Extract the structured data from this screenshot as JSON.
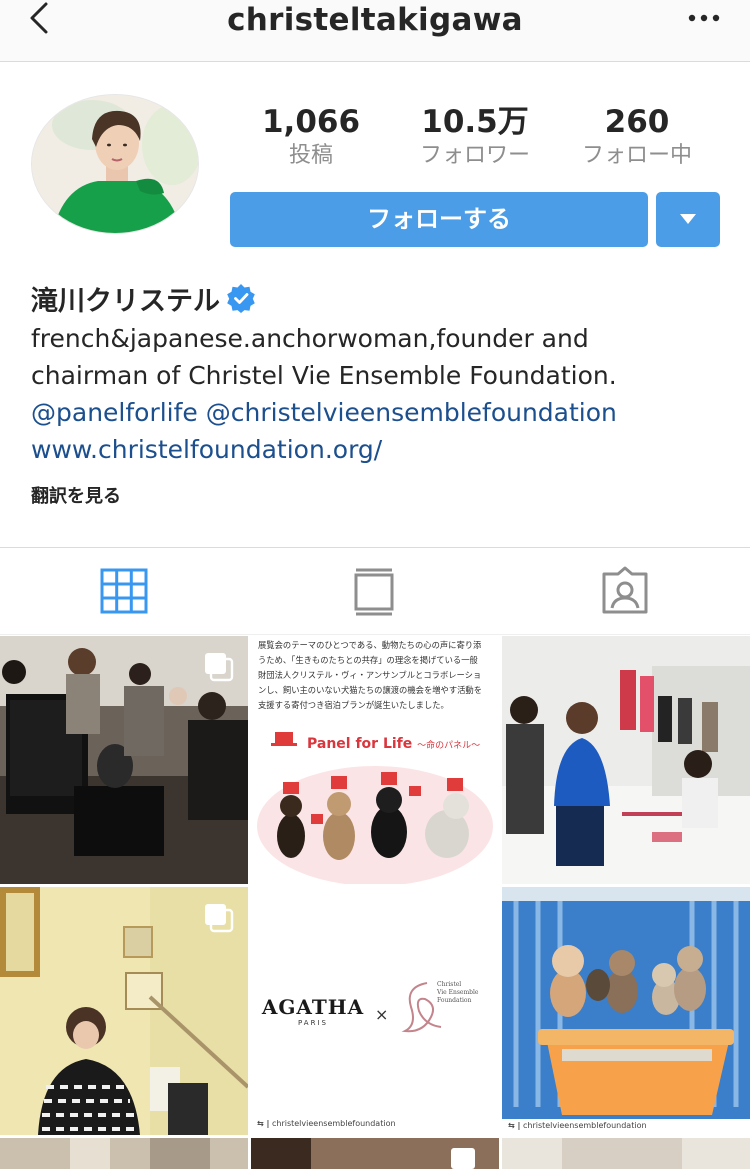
{
  "header": {
    "title": "christeltakigawa"
  },
  "profile": {
    "stats": {
      "posts_count": "1,066",
      "posts_label": "投稿",
      "followers_count": "10.5万",
      "followers_label": "フォロワー",
      "following_count": "260",
      "following_label": "フォロー中"
    },
    "follow_label": "フォローする",
    "name": "滝川クリステル",
    "bio_line1": "french&japanese.anchorwoman,founder and",
    "bio_line2": "chairman of Christel Vie Ensemble Foundation.",
    "mentions": "@panelforlife @christelvieensemblefoundation",
    "website": "www.christelfoundation.org/",
    "translate_label": "翻訳を見る"
  },
  "posts": {
    "post2": {
      "text_line1": "展覧会のテーマのひとつである、動物たちの心の声に寄り添",
      "text_line2": "うため、「生きものたちとの共存」の理念を掲げている一般",
      "text_line3": "財団法人クリステル・ヴィ・アンサンブルとコラボレーショ",
      "text_line4": "ンし、飼い主のいない犬猫たちの譲渡の機会を増やす活動を",
      "text_line5": "支援する寄付つき宿泊プランが誕生いたしました。",
      "title_en": "Panel for Life",
      "title_jp": "〜命のパネル〜"
    },
    "post5": {
      "brand": "AGATHA",
      "brand_sub": "PARIS",
      "cross": "×",
      "foundation_line1": "Christel",
      "foundation_line2": "Vie Ensemble",
      "foundation_line3": "Foundation",
      "credit": "christelvieensemblefoundation"
    },
    "post6": {
      "credit": "christelvieensemblefoundation"
    }
  },
  "colors": {
    "accent": "#4a9de6",
    "link": "#1c4f8e",
    "verified": "#3897f0",
    "muted": "#8e8e8e"
  }
}
